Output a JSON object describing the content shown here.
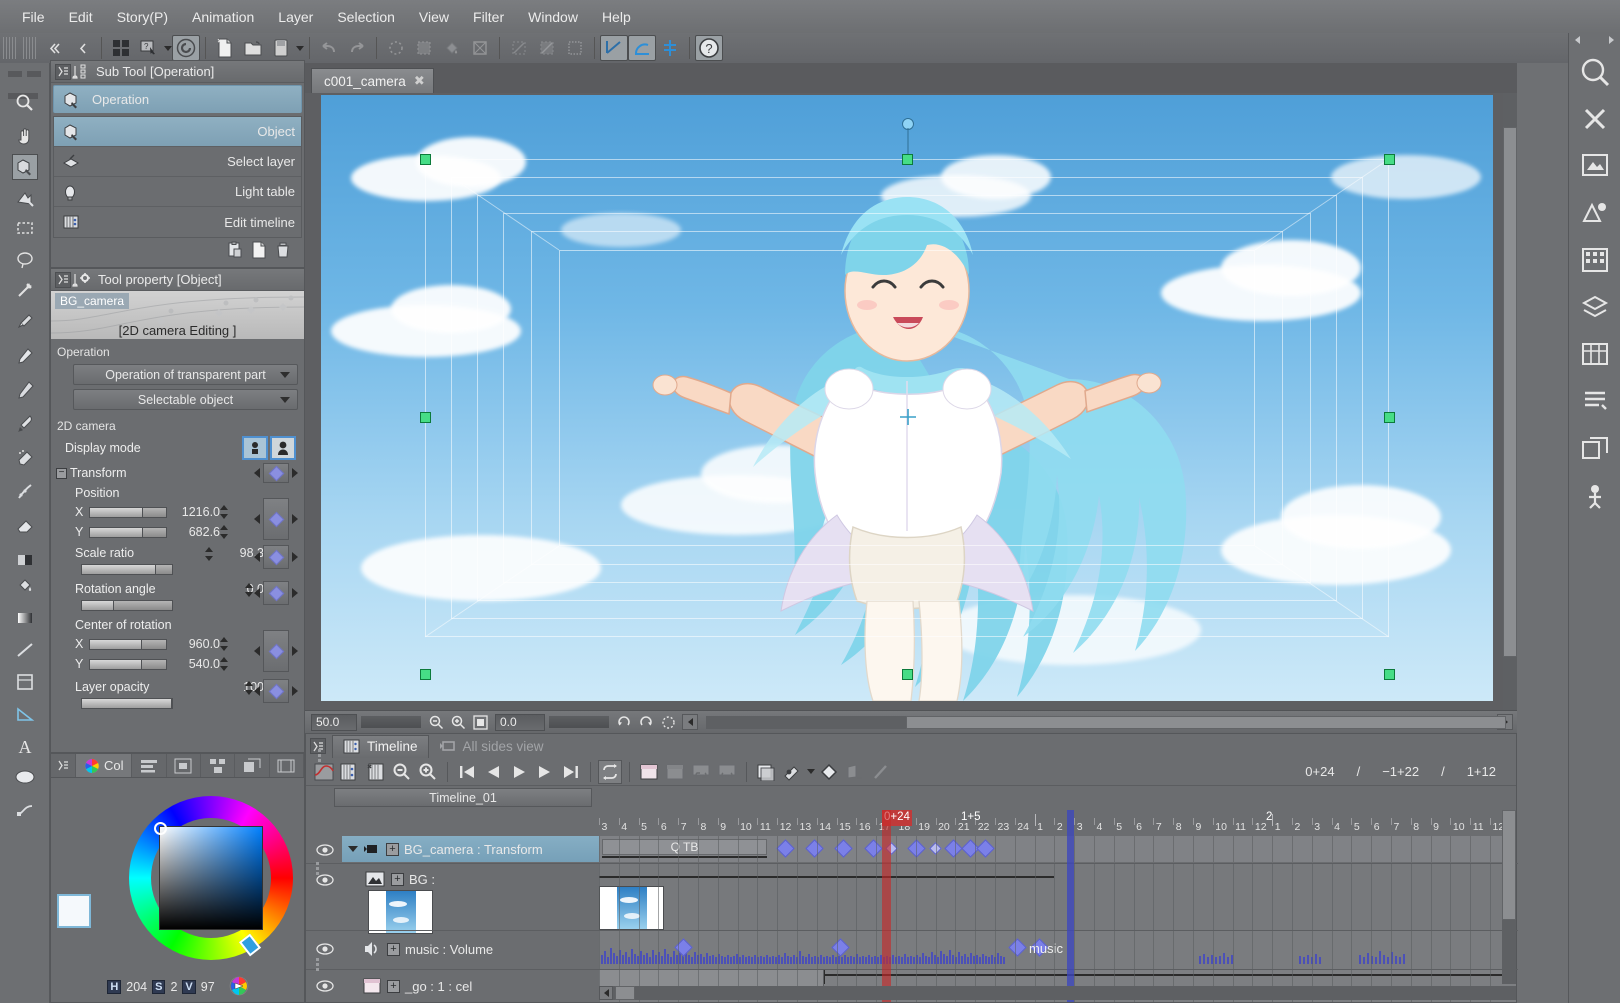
{
  "menubar": {
    "items": [
      "File",
      "Edit",
      "Story(P)",
      "Animation",
      "Layer",
      "Selection",
      "View",
      "Filter",
      "Window",
      "Help"
    ]
  },
  "toolbar": {
    "icons": [
      "grid-icon",
      "navigate-icon",
      "dropdown-caret-icon",
      "clip-studio-icon",
      "new-file-icon",
      "open-file-icon",
      "save-icon",
      "save-dropdown-caret-icon",
      "undo-icon",
      "redo-icon",
      "deselect-icon",
      "select-all-icon",
      "fill-icon",
      "transform-icon",
      "clear-icon",
      "gradient-icon",
      "selection-border-icon",
      "ruler-snap-icon",
      "perspective-snap-icon",
      "symmetry-snap-icon",
      "help-icon"
    ]
  },
  "subtool_panel": {
    "title": "Sub Tool [Operation]",
    "header_item": "Operation",
    "items": [
      {
        "label": "Object",
        "icon": "object-tool-icon",
        "selected": true
      },
      {
        "label": "Select layer",
        "icon": "select-layer-icon",
        "selected": false
      },
      {
        "label": "Light table",
        "icon": "light-table-icon",
        "selected": false
      },
      {
        "label": "Edit timeline",
        "icon": "edit-timeline-icon",
        "selected": false
      }
    ],
    "footer_icons": [
      "paste-setting-icon",
      "new-subtool-icon",
      "delete-subtool-icon"
    ]
  },
  "tool_property": {
    "title": "Tool property [Object]",
    "object_name": "BG_camera",
    "mode_label": "[2D camera Editing ]",
    "operation_group": "Operation",
    "operation_combo": "Operation of transparent part",
    "selectable_combo": "Selectable object",
    "camera_group": "2D camera",
    "display_mode_label": "Display mode",
    "transform_group": "Transform",
    "position_label": "Position",
    "position_x_label": "X",
    "position_x_value": "1216.0",
    "position_y_label": "Y",
    "position_y_value": "682.6",
    "scale_label": "Scale ratio",
    "scale_value": "98.3",
    "rotation_label": "Rotation angle",
    "rotation_value": "0.0",
    "center_label": "Center of rotation",
    "center_x_label": "X",
    "center_x_value": "960.0",
    "center_y_label": "Y",
    "center_y_value": "540.0",
    "opacity_label": "Layer opacity",
    "opacity_value": "100"
  },
  "color_panel": {
    "tab_label": "Col",
    "tabs": [
      "color-wheel-icon",
      "color-slider-icon",
      "color-set-icon",
      "color-history-icon",
      "sub-view-icon",
      "animation-cels-icon"
    ],
    "hsv": {
      "h_key": "H",
      "h_value": "204",
      "s_key": "S",
      "s_value": "2",
      "v_key": "V",
      "v_value": "97"
    }
  },
  "canvas": {
    "tab_name": "c001_camera",
    "tab_close": "✖",
    "status": {
      "zoom_value": "50.0",
      "rotation_value": "0.0",
      "icons": [
        "zoom-out-icon",
        "zoom-in-icon",
        "fit-screen-icon",
        "rotate-left-icon",
        "rotate-right-icon",
        "reset-rotation-icon"
      ]
    }
  },
  "timeline": {
    "tabs": [
      {
        "label": "Timeline",
        "icon": "timeline-icon",
        "active": true
      },
      {
        "label": "All sides view",
        "icon": "camera-icon",
        "active": false
      }
    ],
    "toolbar_icons": [
      "edit-curve-icon",
      "new-timeline-icon",
      "delete-timeline-icon",
      "zoom-out-icon",
      "zoom-in-icon",
      "first-frame-icon",
      "prev-frame-icon",
      "play-icon",
      "next-frame-icon",
      "last-frame-icon",
      "loop-icon",
      "new-cel-icon",
      "specify-cel-icon",
      "link-cel-icon",
      "unlink-cel-icon",
      "onion-skin-icon",
      "light-table-icon",
      "light-table-caret-icon",
      "keyframe-icon",
      "interpolation-icon",
      "edit-curve2-icon"
    ],
    "counter": {
      "current": "0+24",
      "sep1": "/",
      "total": "−1+22",
      "sep2": "/",
      "end": "1+12"
    },
    "name_combo": "Timeline_01",
    "playhead_marker": "0+24",
    "secondary_marker": "1+5",
    "section_marker": "2",
    "layers": [
      {
        "name": "BG_camera : Transform",
        "icon": "camera-icon",
        "selected": true,
        "expanded": true,
        "clip_label": "Q TB"
      },
      {
        "name": "BG :",
        "icon": "image-layer-icon",
        "selected": false,
        "expanded": false
      },
      {
        "name": "music : Volume",
        "icon": "audio-icon",
        "selected": false,
        "expanded": false,
        "waveform_label": "music"
      },
      {
        "name": "_go : 1 : cel",
        "icon": "animation-folder-icon",
        "selected": false,
        "expanded": false
      }
    ],
    "ruler_ticks": [
      "3",
      "4",
      "5",
      "6",
      "7",
      "8",
      "9",
      "10",
      "11",
      "12",
      "13",
      "14",
      "15",
      "16",
      "17",
      "18",
      "19",
      "20",
      "21",
      "22",
      "23",
      "24",
      "1",
      "2",
      "3",
      "4",
      "5",
      "6",
      "7",
      "8",
      "9",
      "10",
      "11",
      "12",
      "1",
      "2",
      "3",
      "4",
      "5",
      "6",
      "7",
      "8",
      "9",
      "10",
      "11",
      "12"
    ]
  },
  "left_tools": {
    "items": [
      "magnifier-icon",
      "hand-icon",
      "operation-icon",
      "move-layer-icon",
      "marquee-icon",
      "lasso-icon",
      "auto-select-icon",
      "eyedropper-icon",
      "pen-icon",
      "pencil-icon",
      "brush-icon",
      "airbrush-icon",
      "decoration-icon",
      "eraser-icon",
      "blend-icon",
      "fill-icon",
      "gradient-icon",
      "figure-icon",
      "frame-border-icon",
      "ruler-icon",
      "text-icon",
      "balloon-icon",
      "correct-line-icon"
    ]
  },
  "right_tools": {
    "items": [
      "search-icon",
      "close-panel-icon",
      "layer-property-icon",
      "material-icon",
      "navigator-icon",
      "layer-icon",
      "timeline-panel-icon",
      "history-icon",
      "subview-icon",
      "animation-icon"
    ]
  },
  "colors": {
    "panel_bg": "#6b6d70",
    "accent_blue": "#7ea0b4",
    "keyframe_purple": "#7b80e8",
    "playhead_red": "#c82828",
    "handle_green": "#46dd86"
  }
}
